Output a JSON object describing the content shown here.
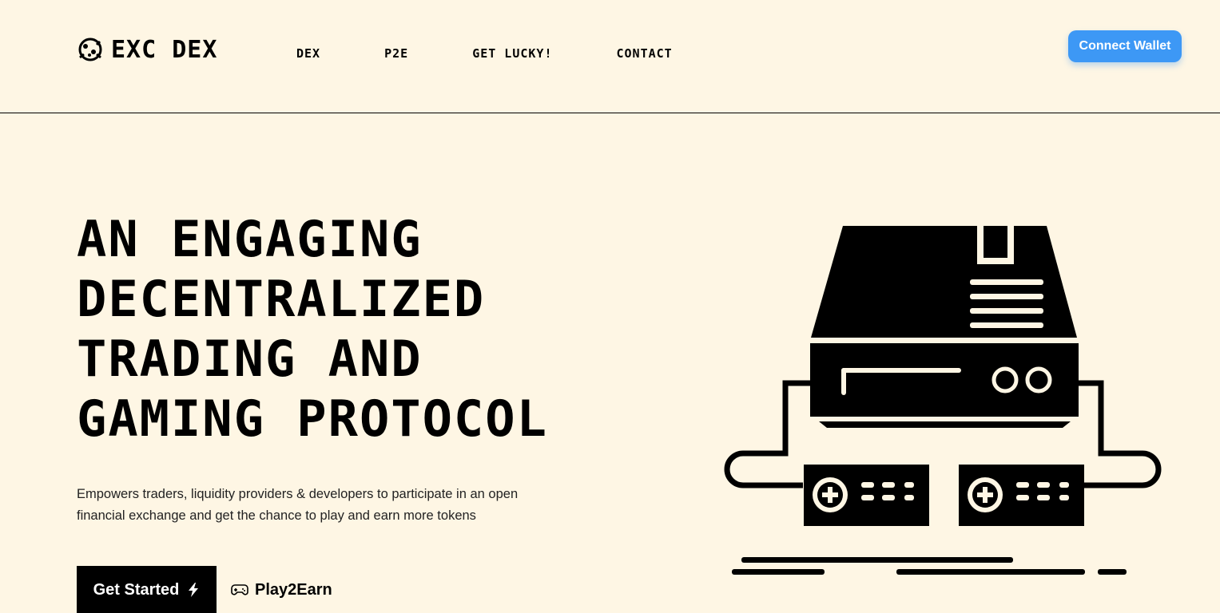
{
  "brand": {
    "name": "EXC DEX",
    "icon": "frog-logo-icon"
  },
  "nav": [
    {
      "label": "DEX"
    },
    {
      "label": "P2E"
    },
    {
      "label": "GET LUCKY!"
    },
    {
      "label": "CONTACT"
    }
  ],
  "connect_wallet_label": "Connect Wallet",
  "hero": {
    "title_lines": [
      "AN ENGAGING",
      "DECENTRALIZED",
      "TRADING AND",
      "GAMING PROTOCOL"
    ],
    "subtitle_lines": [
      "Empowers traders, liquidity providers & developers to participate in an open",
      "financial exchange and get the chance to play and earn more tokens"
    ]
  },
  "cta": {
    "get_started_label": "Get Started",
    "get_started_icon": "lightning-icon",
    "play2earn_label": "Play2Earn",
    "play2earn_icon": "gamepad-icon"
  },
  "colors": {
    "background": "#fef6e4",
    "accent": "#3d98f5",
    "text": "#000000"
  },
  "illustration": "retro-game-console-illustration"
}
